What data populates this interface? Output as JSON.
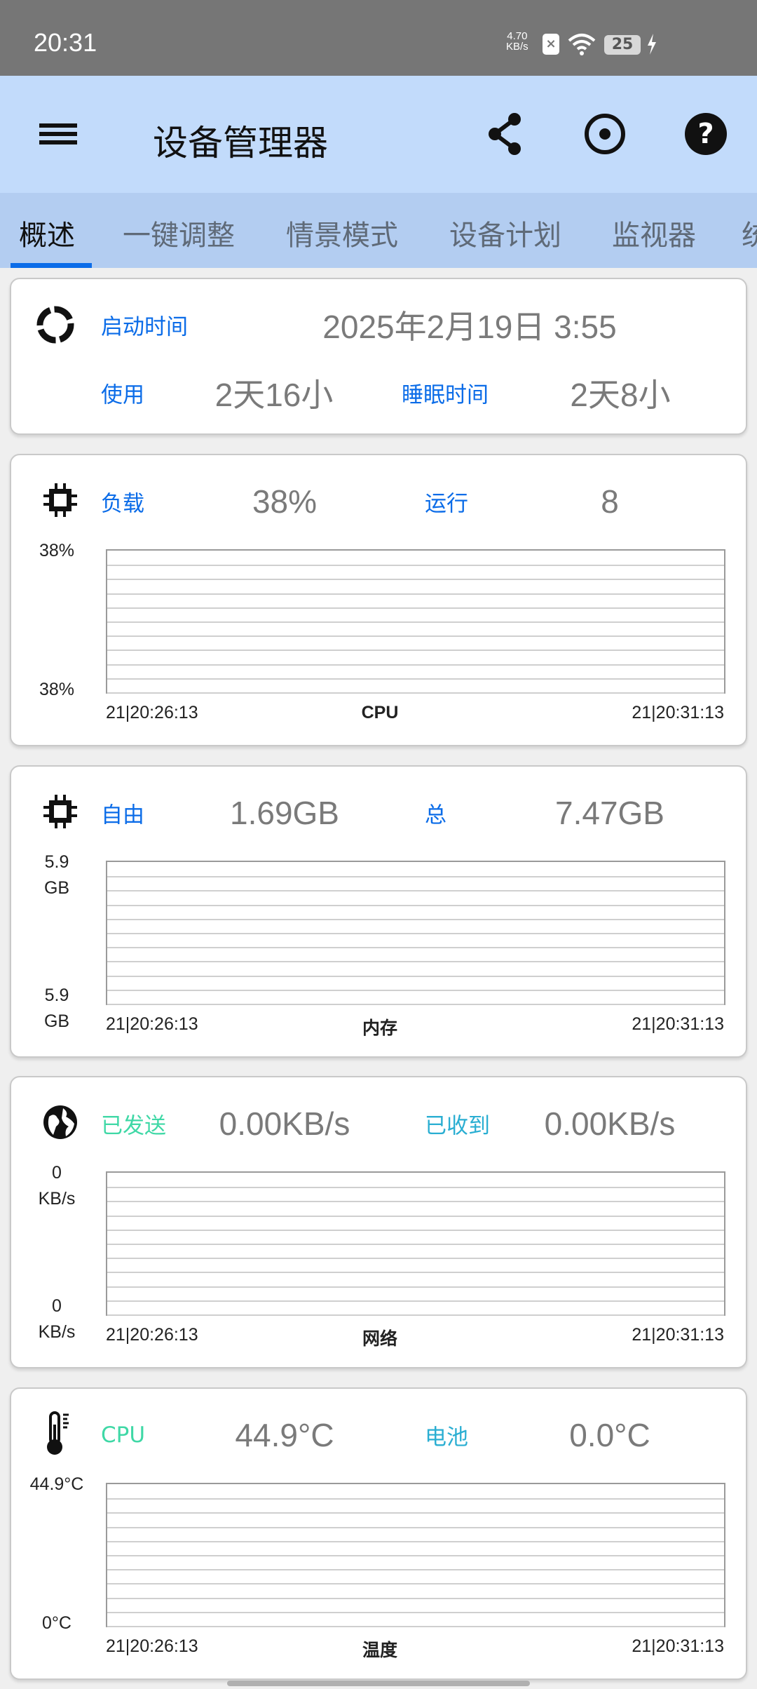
{
  "status_bar": {
    "time": "20:31",
    "net_speed": "4.70",
    "net_unit": "KB/s",
    "battery": "25"
  },
  "app_bar": {
    "title": "设备管理器",
    "icons": [
      "menu-icon",
      "share-icon",
      "record-icon",
      "help-icon"
    ]
  },
  "tabs": [
    {
      "label": "概述",
      "active": true
    },
    {
      "label": "一键调整"
    },
    {
      "label": "情景模式"
    },
    {
      "label": "设备计划"
    },
    {
      "label": "监视器"
    },
    {
      "label": "统"
    }
  ],
  "colors": {
    "blue": "#0b6ce8",
    "green": "#3fd8a6",
    "cyan": "#2aaed2",
    "value_gray": "#7a7a7a"
  },
  "uptime": {
    "boot_label": "启动时间",
    "boot_value": "2025年2月19日 3:55",
    "use_label": "使用",
    "use_value": "2天16小",
    "sleep_label": "睡眠时间",
    "sleep_value": "2天8小"
  },
  "cards": [
    {
      "icon": "cpu-chip-icon",
      "label1": "负载",
      "value1": "38%",
      "label2": "运行",
      "value2": "8",
      "color1": "#0b6ce8",
      "color2": "#0b6ce8",
      "y_top": "38%",
      "y_bottom": "38%",
      "x_start": "21|20:26:13",
      "x_title": "CPU",
      "x_end": "21|20:31:13"
    },
    {
      "icon": "memory-chip-icon",
      "label1": "自由",
      "value1": "1.69GB",
      "label2": "总",
      "value2": "7.47GB",
      "color1": "#0b6ce8",
      "color2": "#0b6ce8",
      "y_top": "5.9\nGB",
      "y_bottom": "5.9\nGB",
      "x_start": "21|20:26:13",
      "x_title": "内存",
      "x_end": "21|20:31:13"
    },
    {
      "icon": "globe-icon",
      "label1": "已发送",
      "value1": "0.00KB/s",
      "label2": "已收到",
      "value2": "0.00KB/s",
      "color1": "#3fd8a6",
      "color2": "#2aaed2",
      "y_top": "0\nKB/s",
      "y_bottom": "0\nKB/s",
      "x_start": "21|20:26:13",
      "x_title": "网络",
      "x_end": "21|20:31:13"
    },
    {
      "icon": "thermometer-icon",
      "label1": "CPU",
      "value1": "44.9°C",
      "label2": "电池",
      "value2": "0.0°C",
      "color1": "#3fd8a6",
      "color2": "#2aaed2",
      "y_top": "44.9°C",
      "y_bottom": "0°C",
      "x_start": "21|20:26:13",
      "x_title": "温度",
      "x_end": "21|20:31:13"
    }
  ]
}
